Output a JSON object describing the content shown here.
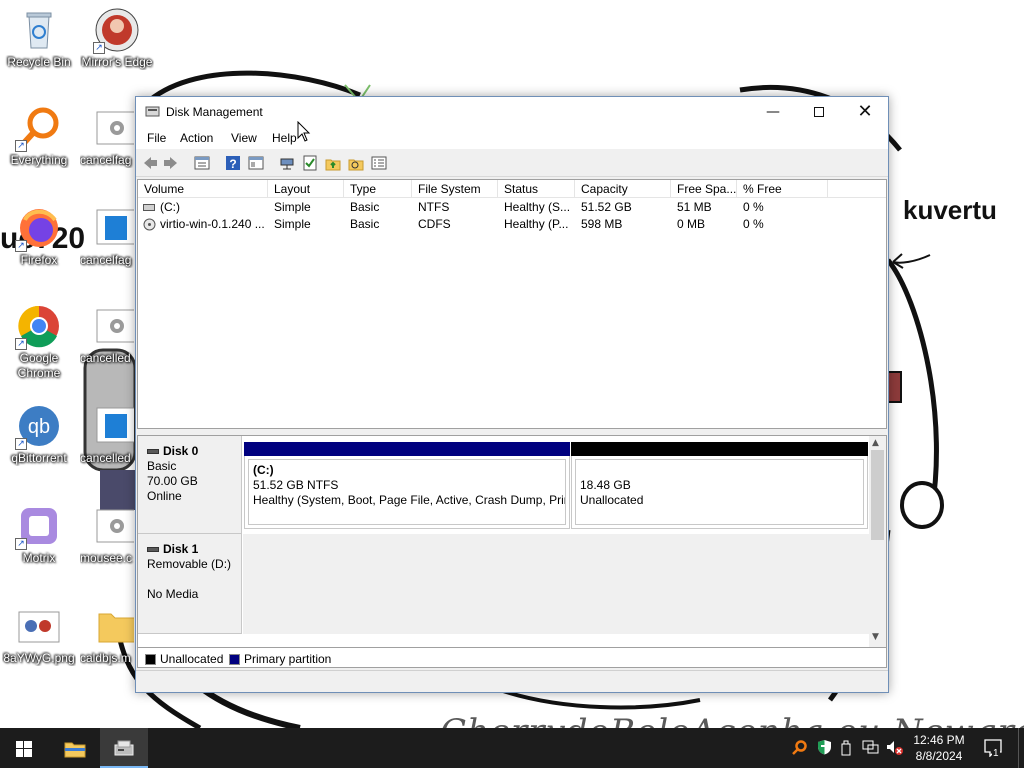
{
  "desktop": {
    "wallpaper_text_right": "kuvertu",
    "wallpaper_text_left": "ue720",
    "wallpaper_signature": "CherrydoBoloAconha ou Newgrounds",
    "icons": [
      {
        "label": "Recycle Bin",
        "icon": "recycle-bin-icon"
      },
      {
        "label": "Mirror's Edge",
        "icon": "game-icon"
      },
      {
        "label": "Everything",
        "icon": "search-app-icon"
      },
      {
        "label": "cancelfag",
        "icon": "settings-file-icon"
      },
      {
        "label": "Firefox",
        "icon": "firefox-icon"
      },
      {
        "label": "cancelfag",
        "icon": "window-file-icon"
      },
      {
        "label": "Google Chrome",
        "icon": "chrome-icon"
      },
      {
        "label": "cancelled",
        "icon": "settings-file-icon"
      },
      {
        "label": "qBittorrent",
        "icon": "qbittorrent-icon"
      },
      {
        "label": "cancelled",
        "icon": "window-file-icon"
      },
      {
        "label": "Motrix",
        "icon": "motrix-icon"
      },
      {
        "label": "mousee.c",
        "icon": "settings-file-icon"
      },
      {
        "label": "8aYWyG.png",
        "icon": "image-file-icon"
      },
      {
        "label": "caldbjs.m",
        "icon": "folder-icon"
      }
    ]
  },
  "window": {
    "title": "Disk Management",
    "menu": [
      "File",
      "Action",
      "View",
      "Help"
    ],
    "toolbar_icons": [
      "back-icon",
      "forward-icon",
      "properties-icon",
      "help-icon",
      "view-icon",
      "connect-icon",
      "check-icon",
      "folder-up-icon",
      "folder-search-icon",
      "list-icon"
    ]
  },
  "volume_list": {
    "columns": [
      "Volume",
      "Layout",
      "Type",
      "File System",
      "Status",
      "Capacity",
      "Free Spa...",
      "% Free"
    ],
    "rows": [
      {
        "volume": "(C:)",
        "layout": "Simple",
        "type": "Basic",
        "fs": "NTFS",
        "status": "Healthy (S...",
        "capacity": "51.52 GB",
        "free": "51 MB",
        "pct": "0 %"
      },
      {
        "volume": "virtio-win-0.1.240 ...",
        "layout": "Simple",
        "type": "Basic",
        "fs": "CDFS",
        "status": "Healthy (P...",
        "capacity": "598 MB",
        "free": "0 MB",
        "pct": "0 %"
      }
    ]
  },
  "disks": [
    {
      "name": "Disk 0",
      "type": "Basic",
      "size": "70.00 GB",
      "state": "Online"
    },
    {
      "name": "Disk 1",
      "type": "Removable (D:)",
      "size": "",
      "state": "No Media"
    }
  ],
  "partitions": [
    {
      "name": "(C:)",
      "size": "51.52 GB NTFS",
      "status": "Healthy (System, Boot, Page File, Active, Crash Dump, Prim",
      "color": "#00007f"
    },
    {
      "name": "",
      "size": "18.48 GB",
      "status": "Unallocated",
      "color": "#000000"
    }
  ],
  "legend": [
    {
      "label": "Unallocated",
      "color": "#000000"
    },
    {
      "label": "Primary partition",
      "color": "#00007f"
    }
  ],
  "taskbar": {
    "time": "12:46 PM",
    "date": "8/8/2024",
    "notifications": "1"
  }
}
